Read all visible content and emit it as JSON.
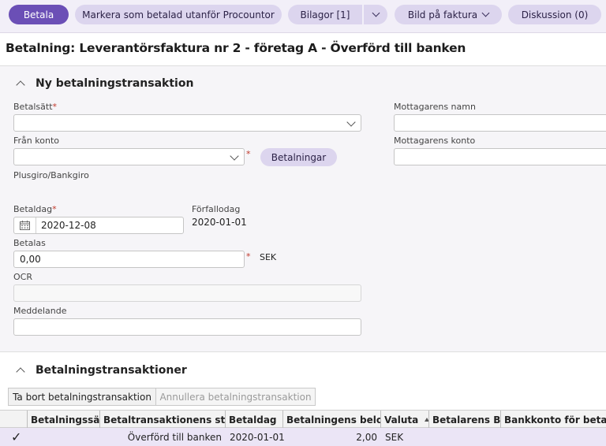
{
  "toolbar": {
    "betala": "Betala",
    "markera": "Markera som betalad utanför Procountor",
    "bilagor": "Bilagor [1]",
    "bild": "Bild på faktura",
    "diskussion": "Diskussion (0)"
  },
  "page_title": "Betalning: Leverantörsfaktura nr 2 - företag A - Överförd till banken",
  "form": {
    "section_title": "Ny betalningstransaktion",
    "betalsatt_label": "Betalsätt",
    "betalsatt_value": "",
    "fran_konto_label": "Från konto",
    "fran_konto_value": "",
    "betalningar_button": "Betalningar",
    "plusgiro_label": "Plusgiro/Bankgiro",
    "betaldag_label": "Betaldag",
    "betaldag_value": "2020-12-08",
    "forfallodag_label": "Förfallodag",
    "forfallodag_value": "2020-01-01",
    "betalas_label": "Betalas",
    "betalas_value": "0,00",
    "currency": "SEK",
    "ocr_label": "OCR",
    "ocr_value": "",
    "meddelande_label": "Meddelande",
    "meddelande_value": "",
    "mottagarens_namn_label": "Mottagarens namn",
    "mottagarens_namn_value": "",
    "mottagarens_konto_label": "Mottagarens konto",
    "mottagarens_konto_value": "",
    "required_mark": "*"
  },
  "transactions": {
    "section_title": "Betalningstransaktioner",
    "delete_button": "Ta bort betalningstransaktion",
    "cancel_button": "Annullera betalningstransaktion",
    "columns": [
      "Betalningssätt",
      "Betaltransaktionens status",
      "Betaldag",
      "Betalningens belopp",
      "Valuta",
      "Betalarens BIC",
      "Bankkonto för betalning"
    ],
    "rows": [
      {
        "checked": "✓",
        "betalningssatt": "",
        "status": "Överförd till banken",
        "betaldag": "2020-01-01",
        "belopp": "2,00",
        "valuta": "SEK",
        "bic": "",
        "bankkonto": ""
      }
    ]
  },
  "icons": {
    "calendar": "calendar-icon",
    "check": "check-icon"
  },
  "colors": {
    "primary": "#6b4fb6",
    "pill": "#dcd5ee",
    "selected_row": "#ebe5f6"
  }
}
